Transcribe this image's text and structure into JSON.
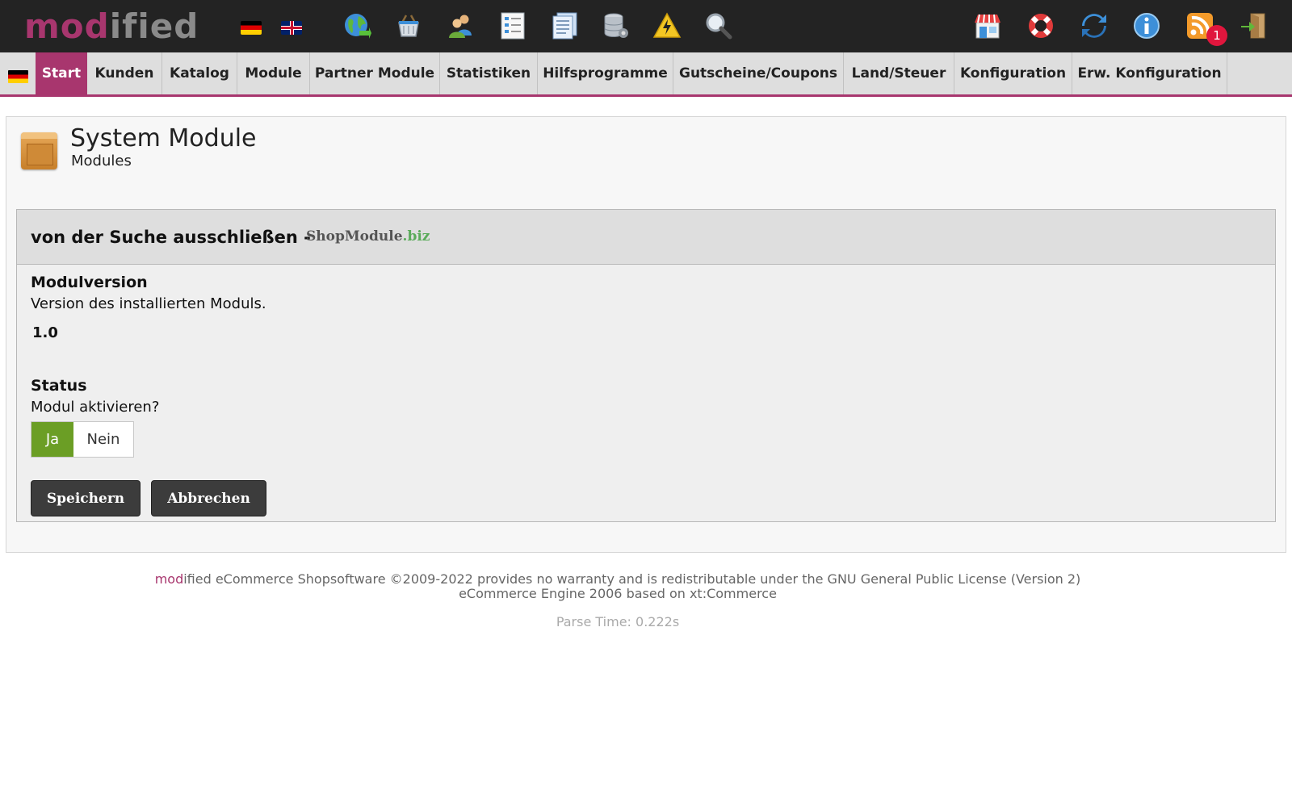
{
  "topbar": {
    "logo_part1": "mod",
    "logo_part2": "ified",
    "notification_count": "1",
    "icons": [
      "globe-icon",
      "basket-icon",
      "customers-icon",
      "list-icon",
      "notes-icon",
      "database-icon",
      "warning-icon",
      "search-icon",
      "shop-icon",
      "support-icon",
      "refresh-icon",
      "info-icon",
      "rss-icon",
      "logout-icon"
    ]
  },
  "nav": {
    "items": [
      {
        "label": "Start"
      },
      {
        "label": "Kunden"
      },
      {
        "label": "Katalog"
      },
      {
        "label": "Module"
      },
      {
        "label": "Partner Module"
      },
      {
        "label": "Statistiken"
      },
      {
        "label": "Hilfsprogramme"
      },
      {
        "label": "Gutscheine/Coupons"
      },
      {
        "label": "Land/Steuer"
      },
      {
        "label": "Konfiguration"
      },
      {
        "label": "Erw. Konfiguration"
      }
    ]
  },
  "page": {
    "title": "System Module",
    "subtitle": "Modules"
  },
  "module": {
    "heading": "von der Suche ausschließen -",
    "brand_main": "ShopModule",
    "brand_suffix": ".biz",
    "version_label": "Modulversion",
    "version_desc": "Version des installierten Moduls.",
    "version_value": "1.0",
    "status_label": "Status",
    "status_desc": "Modul aktivieren?",
    "status_yes": "Ja",
    "status_no": "Nein",
    "status_selected": "Ja",
    "save_label": "Speichern",
    "cancel_label": "Abbrechen"
  },
  "footer": {
    "brand_part1": "mod",
    "line1_rest": "ified eCommerce Shopsoftware ©2009-2022 provides no warranty and is redistributable under the GNU General Public License (Version 2)",
    "line2": "eCommerce Engine 2006 based on xt:Commerce",
    "parse_time": "Parse Time: 0.222s"
  },
  "colors": {
    "accent": "#a8366e",
    "topbar": "#232323",
    "nav": "#dedede",
    "toggle_on": "#6b9e25",
    "badge": "#e0163d"
  }
}
